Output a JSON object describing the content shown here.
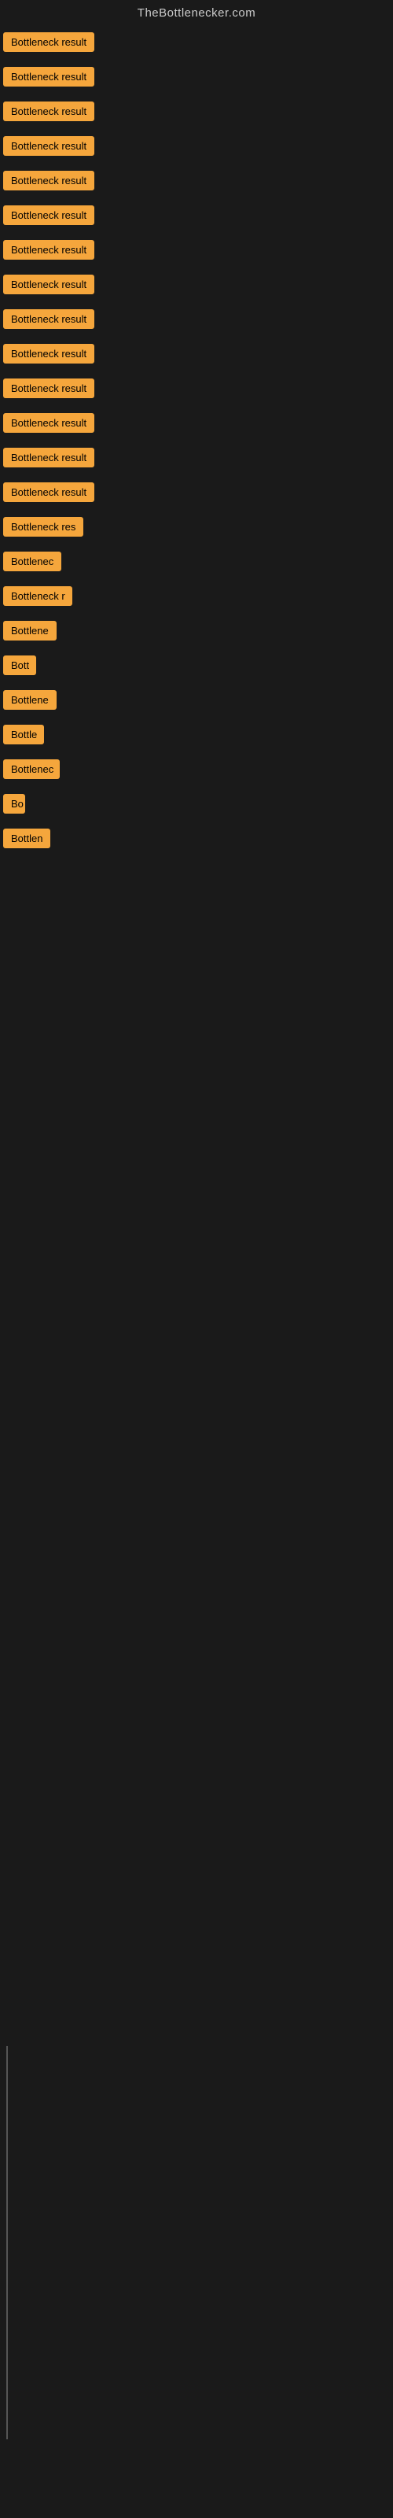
{
  "site": {
    "title": "TheBottlenecker.com"
  },
  "items": [
    {
      "id": 1,
      "label": "Bottleneck result",
      "width": 130
    },
    {
      "id": 2,
      "label": "Bottleneck result",
      "width": 130
    },
    {
      "id": 3,
      "label": "Bottleneck result",
      "width": 130
    },
    {
      "id": 4,
      "label": "Bottleneck result",
      "width": 130
    },
    {
      "id": 5,
      "label": "Bottleneck result",
      "width": 130
    },
    {
      "id": 6,
      "label": "Bottleneck result",
      "width": 130
    },
    {
      "id": 7,
      "label": "Bottleneck result",
      "width": 130
    },
    {
      "id": 8,
      "label": "Bottleneck result",
      "width": 130
    },
    {
      "id": 9,
      "label": "Bottleneck result",
      "width": 130
    },
    {
      "id": 10,
      "label": "Bottleneck result",
      "width": 130
    },
    {
      "id": 11,
      "label": "Bottleneck result",
      "width": 130
    },
    {
      "id": 12,
      "label": "Bottleneck result",
      "width": 130
    },
    {
      "id": 13,
      "label": "Bottleneck result",
      "width": 130
    },
    {
      "id": 14,
      "label": "Bottleneck result",
      "width": 130
    },
    {
      "id": 15,
      "label": "Bottleneck res",
      "width": 108
    },
    {
      "id": 16,
      "label": "Bottlenec",
      "width": 75
    },
    {
      "id": 17,
      "label": "Bottleneck r",
      "width": 88
    },
    {
      "id": 18,
      "label": "Bottlene",
      "width": 68
    },
    {
      "id": 19,
      "label": "Bott",
      "width": 42
    },
    {
      "id": 20,
      "label": "Bottlene",
      "width": 68
    },
    {
      "id": 21,
      "label": "Bottle",
      "width": 52
    },
    {
      "id": 22,
      "label": "Bottlenec",
      "width": 72
    },
    {
      "id": 23,
      "label": "Bo",
      "width": 28
    },
    {
      "id": 24,
      "label": "Bottlen",
      "width": 60
    }
  ]
}
